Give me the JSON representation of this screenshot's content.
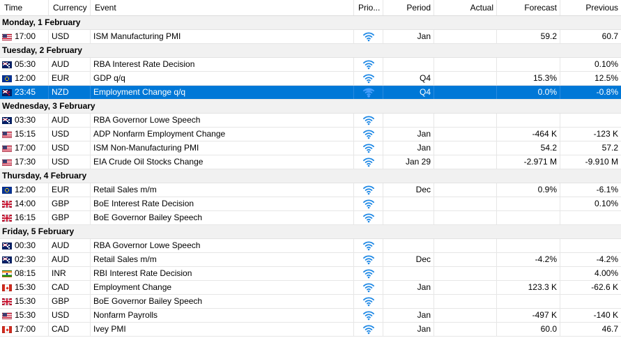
{
  "columns": {
    "time": "Time",
    "currency": "Currency",
    "event": "Event",
    "priority": "Prio...",
    "period": "Period",
    "actual": "Actual",
    "forecast": "Forecast",
    "previous": "Previous"
  },
  "colors": {
    "selection": "#0078d7",
    "priority_icon": "#1e88e5",
    "day_header_bg": "#f1f1f1"
  },
  "days": [
    {
      "label": "Monday, 1 February",
      "events": [
        {
          "flag": "usd",
          "time": "17:00",
          "currency": "USD",
          "event": "ISM Manufacturing PMI",
          "priority_icon": "wifi-icon",
          "period": "Jan",
          "actual": "",
          "forecast": "59.2",
          "previous": "60.7",
          "selected": false
        }
      ]
    },
    {
      "label": "Tuesday, 2 February",
      "events": [
        {
          "flag": "aud",
          "time": "05:30",
          "currency": "AUD",
          "event": "RBA Interest Rate Decision",
          "priority_icon": "wifi-icon",
          "period": "",
          "actual": "",
          "forecast": "",
          "previous": "0.10%",
          "selected": false
        },
        {
          "flag": "eur",
          "time": "12:00",
          "currency": "EUR",
          "event": "GDP q/q",
          "priority_icon": "wifi-icon",
          "period": "Q4",
          "actual": "",
          "forecast": "15.3%",
          "previous": "12.5%",
          "selected": false
        },
        {
          "flag": "nzd",
          "time": "23:45",
          "currency": "NZD",
          "event": "Employment Change q/q",
          "priority_icon": "wifi-icon",
          "period": "Q4",
          "actual": "",
          "forecast": "0.0%",
          "previous": "-0.8%",
          "selected": true
        }
      ]
    },
    {
      "label": "Wednesday, 3 February",
      "events": [
        {
          "flag": "aud",
          "time": "03:30",
          "currency": "AUD",
          "event": "RBA Governor Lowe Speech",
          "priority_icon": "wifi-icon",
          "period": "",
          "actual": "",
          "forecast": "",
          "previous": "",
          "selected": false
        },
        {
          "flag": "usd",
          "time": "15:15",
          "currency": "USD",
          "event": "ADP Nonfarm Employment Change",
          "priority_icon": "wifi-icon",
          "period": "Jan",
          "actual": "",
          "forecast": "-464 K",
          "previous": "-123 K",
          "selected": false
        },
        {
          "flag": "usd",
          "time": "17:00",
          "currency": "USD",
          "event": "ISM Non-Manufacturing PMI",
          "priority_icon": "wifi-icon",
          "period": "Jan",
          "actual": "",
          "forecast": "54.2",
          "previous": "57.2",
          "selected": false
        },
        {
          "flag": "usd",
          "time": "17:30",
          "currency": "USD",
          "event": "EIA Crude Oil Stocks Change",
          "priority_icon": "wifi-icon",
          "period": "Jan 29",
          "actual": "",
          "forecast": "-2.971 M",
          "previous": "-9.910 M",
          "selected": false
        }
      ]
    },
    {
      "label": "Thursday, 4 February",
      "events": [
        {
          "flag": "eur",
          "time": "12:00",
          "currency": "EUR",
          "event": "Retail Sales m/m",
          "priority_icon": "wifi-icon",
          "period": "Dec",
          "actual": "",
          "forecast": "0.9%",
          "previous": "-6.1%",
          "selected": false
        },
        {
          "flag": "gbp",
          "time": "14:00",
          "currency": "GBP",
          "event": "BoE Interest Rate Decision",
          "priority_icon": "wifi-icon",
          "period": "",
          "actual": "",
          "forecast": "",
          "previous": "0.10%",
          "selected": false
        },
        {
          "flag": "gbp",
          "time": "16:15",
          "currency": "GBP",
          "event": "BoE Governor Bailey Speech",
          "priority_icon": "wifi-icon",
          "period": "",
          "actual": "",
          "forecast": "",
          "previous": "",
          "selected": false
        }
      ]
    },
    {
      "label": "Friday, 5 February",
      "events": [
        {
          "flag": "aud",
          "time": "00:30",
          "currency": "AUD",
          "event": "RBA Governor Lowe Speech",
          "priority_icon": "wifi-icon",
          "period": "",
          "actual": "",
          "forecast": "",
          "previous": "",
          "selected": false
        },
        {
          "flag": "aud",
          "time": "02:30",
          "currency": "AUD",
          "event": "Retail Sales m/m",
          "priority_icon": "wifi-icon",
          "period": "Dec",
          "actual": "",
          "forecast": "-4.2%",
          "previous": "-4.2%",
          "selected": false
        },
        {
          "flag": "inr",
          "time": "08:15",
          "currency": "INR",
          "event": "RBI Interest Rate Decision",
          "priority_icon": "wifi-icon",
          "period": "",
          "actual": "",
          "forecast": "",
          "previous": "4.00%",
          "selected": false
        },
        {
          "flag": "cad",
          "time": "15:30",
          "currency": "CAD",
          "event": "Employment Change",
          "priority_icon": "wifi-icon",
          "period": "Jan",
          "actual": "",
          "forecast": "123.3 K",
          "previous": "-62.6 K",
          "selected": false
        },
        {
          "flag": "gbp",
          "time": "15:30",
          "currency": "GBP",
          "event": "BoE Governor Bailey Speech",
          "priority_icon": "wifi-icon",
          "period": "",
          "actual": "",
          "forecast": "",
          "previous": "",
          "selected": false
        },
        {
          "flag": "usd",
          "time": "15:30",
          "currency": "USD",
          "event": "Nonfarm Payrolls",
          "priority_icon": "wifi-icon",
          "period": "Jan",
          "actual": "",
          "forecast": "-497 K",
          "previous": "-140 K",
          "selected": false
        },
        {
          "flag": "cad",
          "time": "17:00",
          "currency": "CAD",
          "event": "Ivey PMI",
          "priority_icon": "wifi-icon",
          "period": "Jan",
          "actual": "",
          "forecast": "60.0",
          "previous": "46.7",
          "selected": false
        }
      ]
    }
  ]
}
